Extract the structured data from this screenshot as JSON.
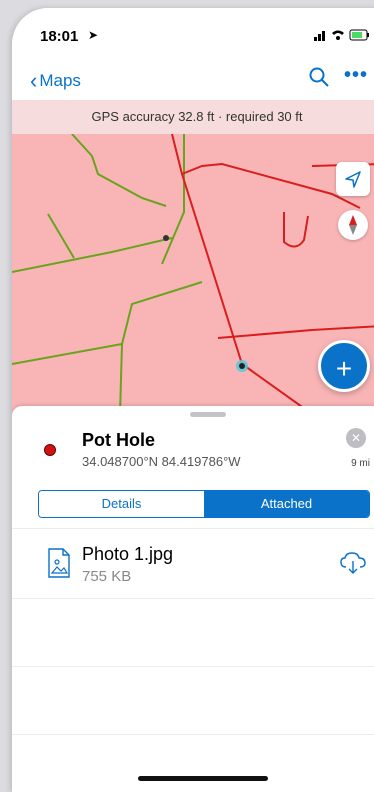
{
  "status_bar": {
    "time": "18:01",
    "location_icon": "location-arrow-icon",
    "icons": "signal-wifi-battery"
  },
  "nav": {
    "back_label": "Maps",
    "search_icon": "search-icon",
    "more_icon": "more-icon",
    "more_glyph": "•••"
  },
  "gps_banner": {
    "text": "GPS accuracy 32.8 ft · required 30 ft"
  },
  "map": {
    "locate_icon": "locate-arrow-icon",
    "compass_icon": "compass-icon",
    "add_label": "+"
  },
  "feature": {
    "title": "Pot Hole",
    "coordinates": "34.048700°N 84.419786°W",
    "distance": "9 mi",
    "close_glyph": "✕",
    "marker_color": "#d21111"
  },
  "tabs": [
    {
      "label": "Details",
      "active": false
    },
    {
      "label": "Attached",
      "active": true
    }
  ],
  "attachments": [
    {
      "name": "Photo 1.jpg",
      "size": "755 KB",
      "icon": "image-file-icon",
      "action_icon": "cloud-download-icon"
    }
  ],
  "colors": {
    "accent": "#0a72c8",
    "map_fill": "#f9b5b6",
    "road_red": "#d81e1e",
    "road_green": "#6aa31e",
    "banner": "#f6dcdc"
  }
}
